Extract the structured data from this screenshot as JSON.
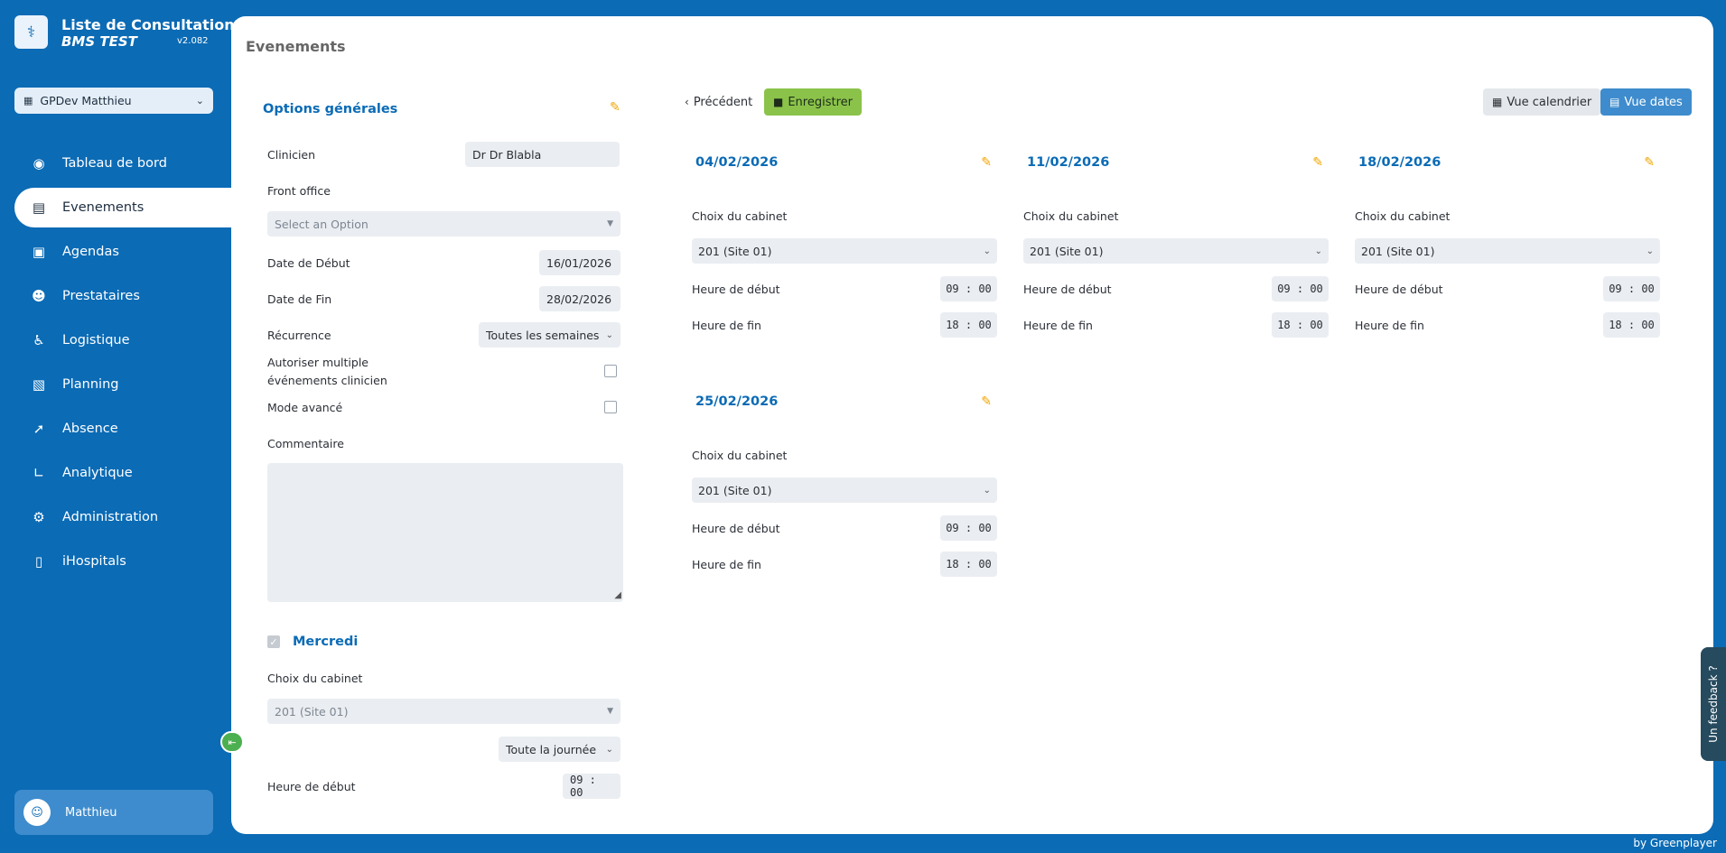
{
  "brand": {
    "title": "Liste de Consultations",
    "subtitle": "BMS TEST",
    "version": "v2.082",
    "icon": "stethoscope-icon"
  },
  "site_select": {
    "value": "GPDev Matthieu"
  },
  "nav": [
    {
      "label": "Tableau de bord",
      "icon": "dashboard-icon"
    },
    {
      "label": "Evenements",
      "icon": "calendar-icon",
      "active": true
    },
    {
      "label": "Agendas",
      "icon": "agenda-icon"
    },
    {
      "label": "Prestataires",
      "icon": "user-icon"
    },
    {
      "label": "Logistique",
      "icon": "logistics-icon"
    },
    {
      "label": "Planning",
      "icon": "planning-icon"
    },
    {
      "label": "Absence",
      "icon": "absence-icon"
    },
    {
      "label": "Analytique",
      "icon": "chart-icon"
    },
    {
      "label": "Administration",
      "icon": "gear-icon"
    },
    {
      "label": "iHospitals",
      "icon": "hospital-icon"
    }
  ],
  "user": {
    "name": "Matthieu"
  },
  "page": {
    "title": "Evenements"
  },
  "options": {
    "title": "Options générales",
    "clinicien_label": "Clinicien",
    "clinicien_value": "Dr  Dr Blabla",
    "front_office_label": "Front office",
    "front_office_placeholder": "Select an Option",
    "date_debut_label": "Date de Début",
    "date_debut_value": "16/01/2026",
    "date_fin_label": "Date de Fin",
    "date_fin_value": "28/02/2026",
    "recurrence_label": "Récurrence",
    "recurrence_value": "Toutes les semaines",
    "multi_label_1": "Autoriser multiple",
    "multi_label_2": "événements clinicien",
    "mode_avance_label": "Mode avancé",
    "commentaire_label": "Commentaire"
  },
  "mercredi": {
    "title": "Mercredi",
    "cabinet_label": "Choix du cabinet",
    "cabinet_value": "201 (Site 01)",
    "period_value": "Toute la journée",
    "heure_debut_label": "Heure de début",
    "heure_debut_value": "09 : 00"
  },
  "toolbar": {
    "prev_label": "Précédent",
    "save_label": "Enregistrer",
    "calendar_view_label": "Vue calendrier",
    "dates_view_label": "Vue dates"
  },
  "cards": [
    {
      "date": "04/02/2026",
      "cabinet_label": "Choix du cabinet",
      "cabinet": "201 (Site 01)",
      "start_label": "Heure de début",
      "start": "09 : 00",
      "end_label": "Heure de fin",
      "end": "18 : 00"
    },
    {
      "date": "11/02/2026",
      "cabinet_label": "Choix du cabinet",
      "cabinet": "201 (Site 01)",
      "start_label": "Heure de début",
      "start": "09 : 00",
      "end_label": "Heure de fin",
      "end": "18 : 00"
    },
    {
      "date": "18/02/2026",
      "cabinet_label": "Choix du cabinet",
      "cabinet": "201 (Site 01)",
      "start_label": "Heure de début",
      "start": "09 : 00",
      "end_label": "Heure de fin",
      "end": "18 : 00"
    },
    {
      "date": "25/02/2026",
      "cabinet_label": "Choix du cabinet",
      "cabinet": "201 (Site 01)",
      "start_label": "Heure de début",
      "start": "09 : 00",
      "end_label": "Heure de fin",
      "end": "18 : 00"
    }
  ],
  "feedback": {
    "label": "Un feedback ?"
  },
  "footer": {
    "byline": "by Greenplayer"
  },
  "colors": {
    "primary": "#0b6bb5",
    "accent": "#f0a500",
    "save": "#8bc34a"
  }
}
